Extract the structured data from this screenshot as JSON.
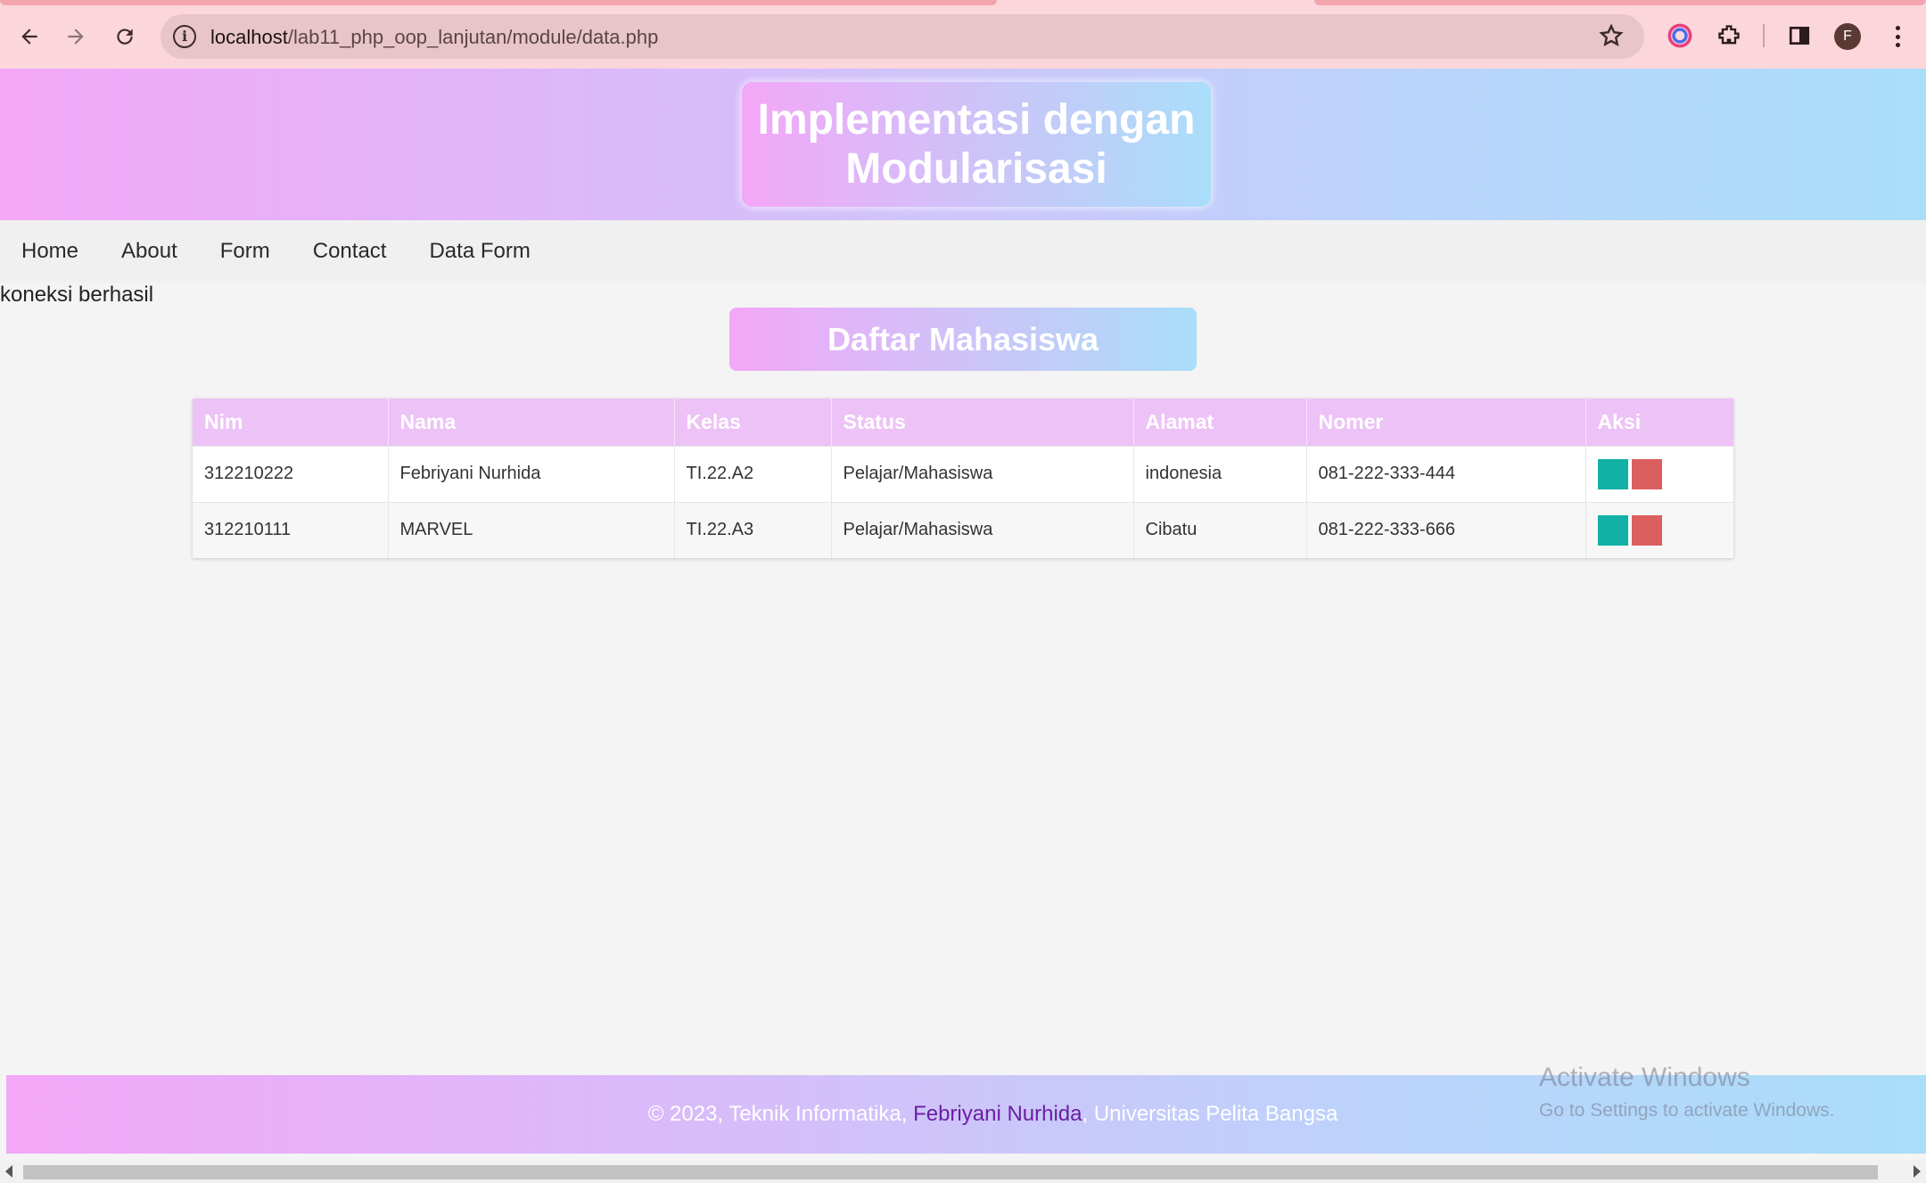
{
  "browser": {
    "url_host": "localhost",
    "url_path": "/lab11_php_oop_lanjutan/module/data.php",
    "profile_initial": "F"
  },
  "header": {
    "title": "Implementasi dengan Modularisasi"
  },
  "nav": {
    "items": [
      "Home",
      "About",
      "Form",
      "Contact",
      "Data Form"
    ]
  },
  "status_message": "koneksi berhasil",
  "page_title": "Daftar Mahasiswa",
  "table": {
    "columns": [
      "Nim",
      "Nama",
      "Kelas",
      "Status",
      "Alamat",
      "Nomer",
      "Aksi"
    ],
    "rows": [
      [
        "312210222",
        "Febriyani Nurhida",
        "TI.22.A2",
        "Pelajar/Mahasiswa",
        "indonesia",
        "081-222-333-444"
      ],
      [
        "312210111",
        "MARVEL",
        "TI.22.A3",
        "Pelajar/Mahasiswa",
        "Cibatu",
        "081-222-333-666"
      ]
    ]
  },
  "footer": {
    "prefix": "© 2023, Teknik Informatika, ",
    "author": "Febriyani Nurhida",
    "suffix": ", Universitas Pelita Bangsa"
  },
  "watermark": {
    "line1": "Activate Windows",
    "line2": "Go to Settings to activate Windows."
  },
  "colors": {
    "edit_button": "#13b0a6",
    "delete_button": "#dc5f5f",
    "accent_pink": "#f3a7f7",
    "accent_blue": "#a9def9"
  },
  "icons": [
    "back-icon",
    "forward-icon",
    "reload-icon",
    "info-icon",
    "star-icon",
    "color-extension-icon",
    "puzzle-extension-icon",
    "side-panel-icon",
    "kebab-menu-icon"
  ]
}
